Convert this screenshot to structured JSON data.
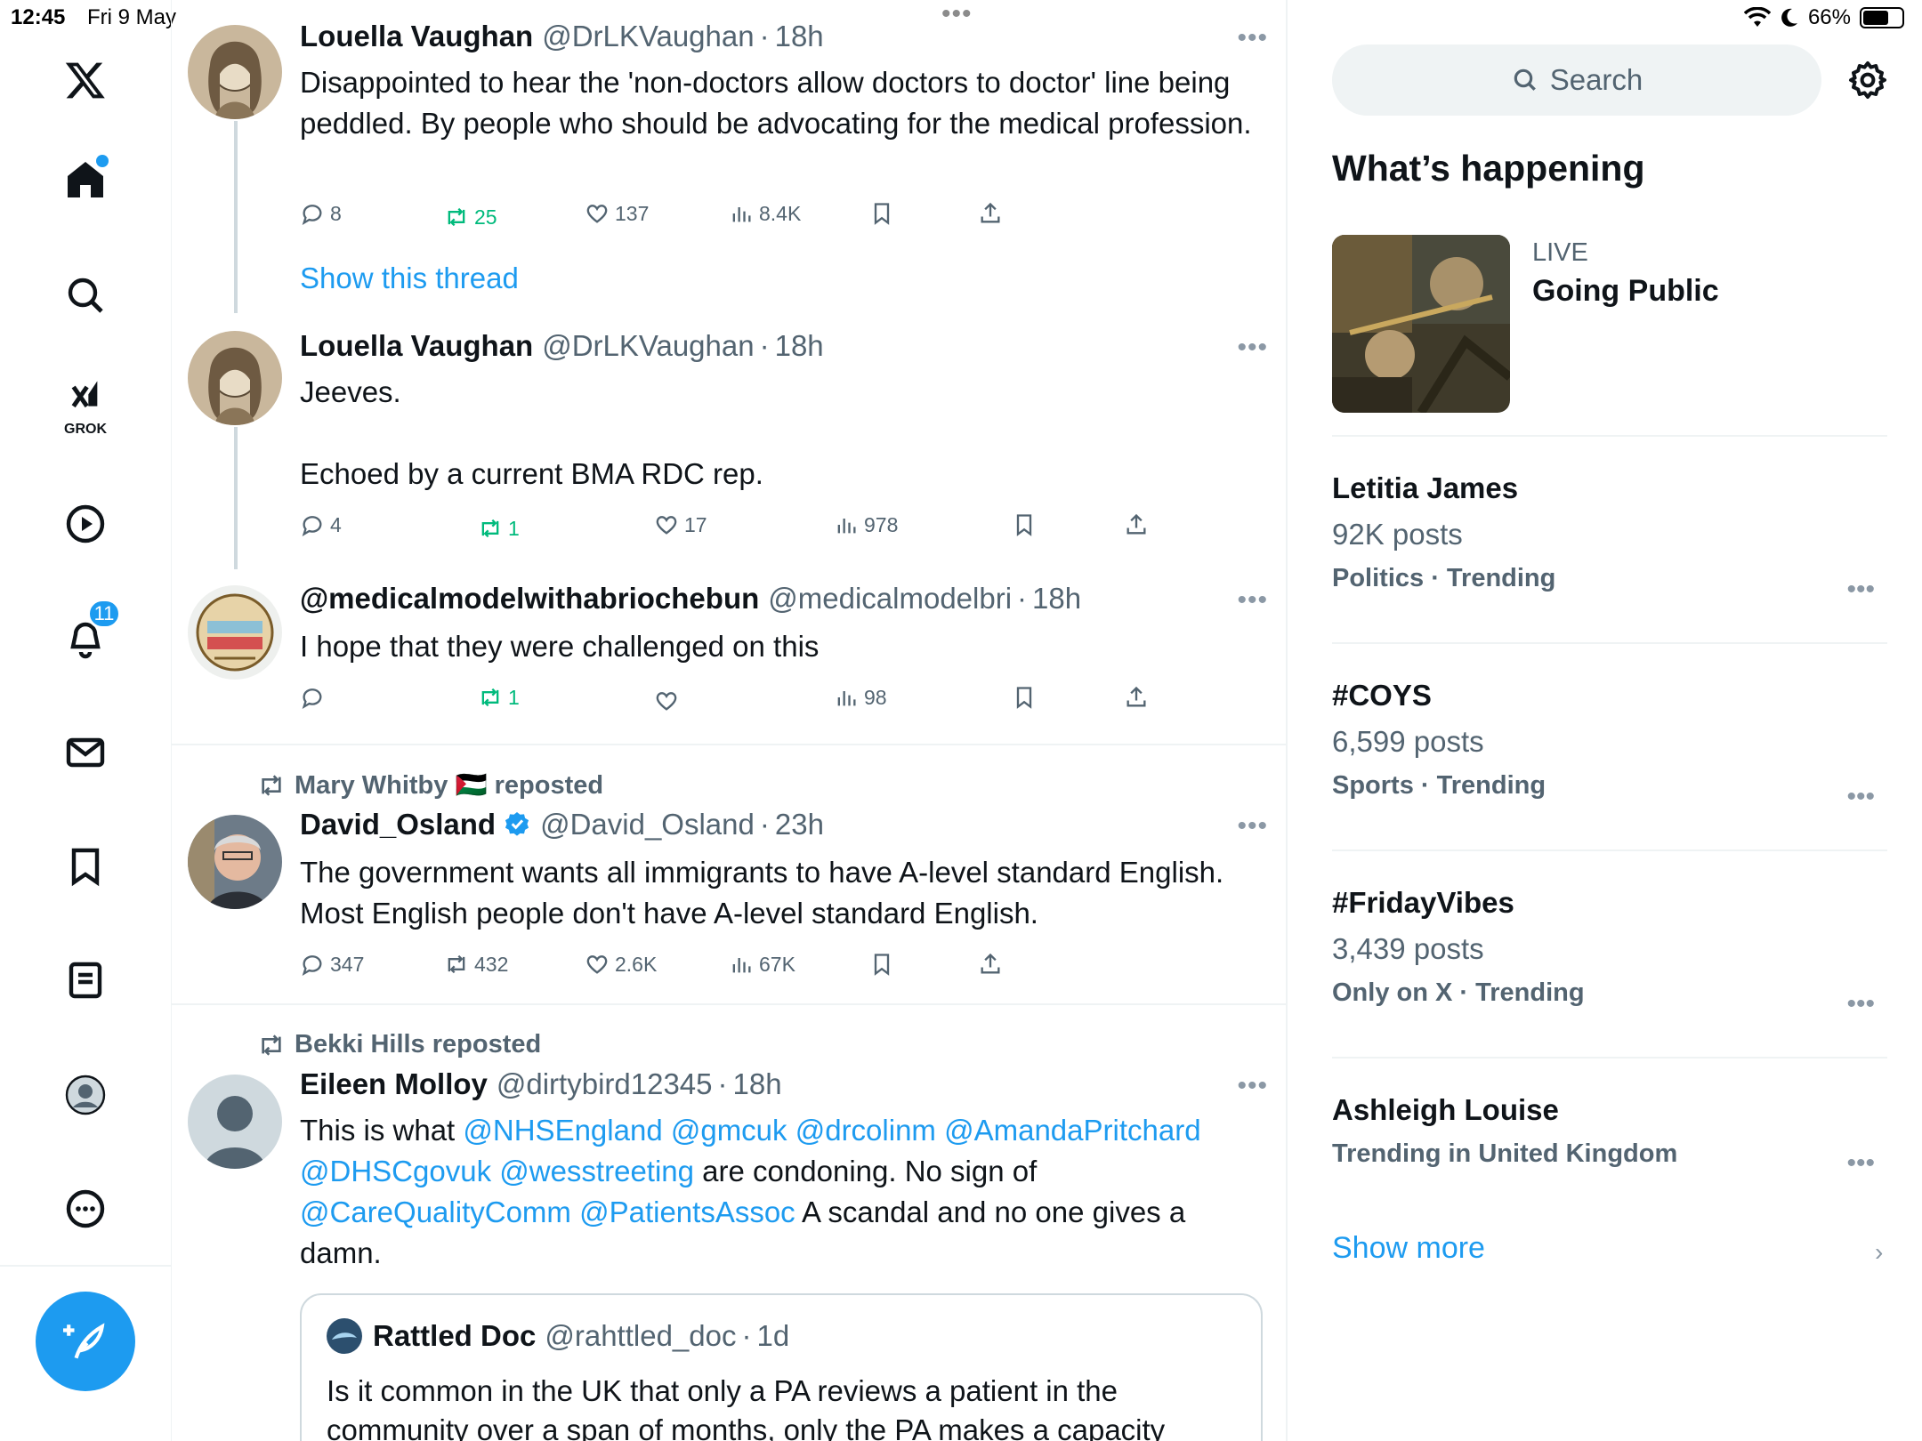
{
  "status_bar": {
    "time": "12:45",
    "date": "Fri 9 May",
    "battery": "66%",
    "battery_level": 0.66
  },
  "nav": {
    "grok_label": "GROK",
    "notifications_count": "11"
  },
  "tweets": [
    {
      "name": "Louella Vaughan",
      "handle": "@DrLKVaughan",
      "time": "18h",
      "text": "Disappointed to hear the 'non-doctors allow doctors to doctor' line being peddled. By people who should be advocating for the medical profession.",
      "replies": "8",
      "reposts": "25",
      "likes": "137",
      "views": "8.4K",
      "show_thread": "Show this thread"
    },
    {
      "name": "Louella Vaughan",
      "handle": "@DrLKVaughan",
      "time": "18h",
      "text_line1": "Jeeves.",
      "text_line2": "Echoed by a current BMA RDC rep.",
      "replies": "4",
      "reposts": "1",
      "likes": "17",
      "views": "978"
    },
    {
      "name": "@medicalmodelwithabriochebun",
      "handle": "@medicalmodelbri",
      "time": "18h",
      "text": "I hope that they were challenged on this",
      "replies": "",
      "reposts": "1",
      "likes": "",
      "views": "98"
    },
    {
      "reposted_by": "Mary Whitby 🇵🇸 reposted",
      "name": "David_Osland",
      "handle": "@David_Osland",
      "time": "23h",
      "text": "The government wants all immigrants to have A-level standard English. Most English people don't have A-level standard English.",
      "replies": "347",
      "reposts": "432",
      "likes": "2.6K",
      "views": "67K"
    },
    {
      "reposted_by": "Bekki Hills reposted",
      "name": "Eileen Molloy",
      "handle": "@dirtybird12345",
      "time": "18h",
      "text_parts": {
        "p1": "This is what ",
        "m1": "@NHSEngland",
        "m2": "@gmcuk",
        "m3": "@drcolinm",
        "m4": "@AmandaPritchard",
        "m5": "@DHSCgovuk",
        "m6": "@wesstreeting",
        "p2": " are condoning. No sign of ",
        "m7": "@CareQualityComm",
        "m8": "@PatientsAssoc",
        "p3": " A scandal and no one gives a damn."
      },
      "quote": {
        "name": "Rattled Doc",
        "handle": "@rahttled_doc",
        "time": "1d",
        "text": "Is it common in the UK that only a PA reviews a patient in the community over a span of months, only the PA makes a capacity"
      }
    }
  ],
  "sidebar": {
    "search_placeholder": "Search",
    "whats_happening": "What’s happening",
    "live": {
      "label": "LIVE",
      "title": "Going Public"
    },
    "trends": [
      {
        "name": "Letitia James",
        "posts": "92K posts",
        "category": "Politics · Trending"
      },
      {
        "name": "#COYS",
        "posts": "6,599 posts",
        "category": "Sports · Trending"
      },
      {
        "name": "#FridayVibes",
        "posts": "3,439 posts",
        "category": "Only on X · Trending"
      },
      {
        "name": "Ashleigh Louise",
        "posts": "",
        "category": "Trending in United Kingdom"
      }
    ],
    "show_more": "Show more"
  },
  "colors": {
    "accent": "#1d9bf0",
    "repost_green": "#00ba7c",
    "muted": "#536471",
    "border": "#eff3f4"
  }
}
